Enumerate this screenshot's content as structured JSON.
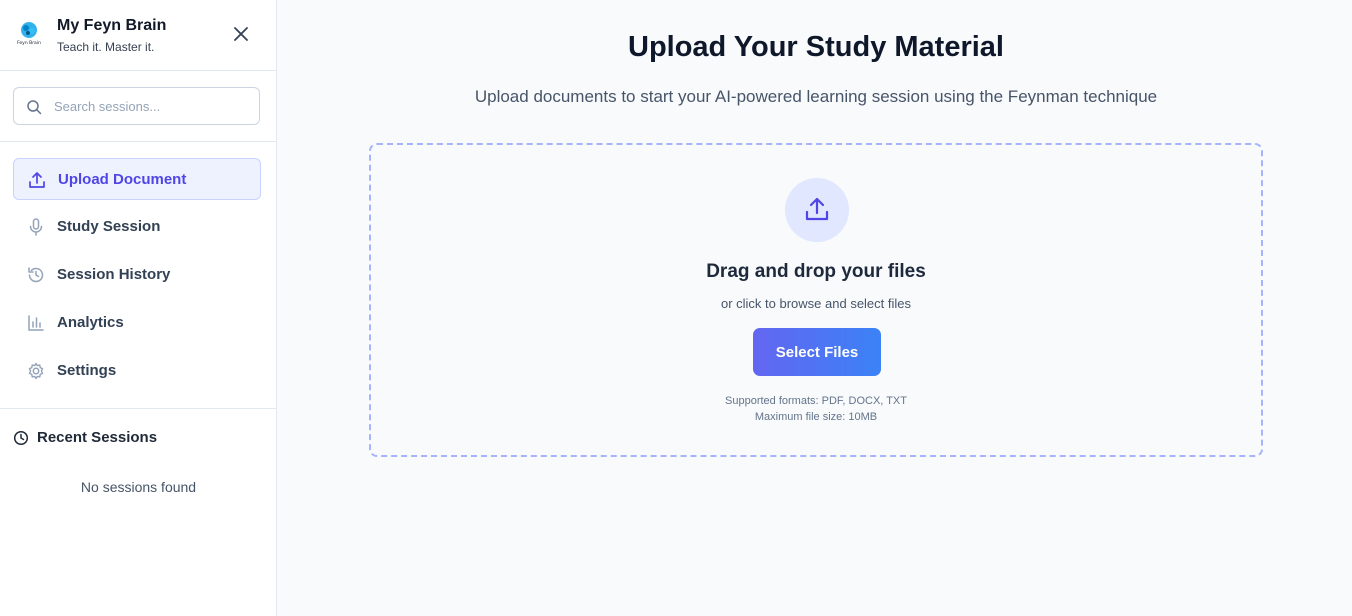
{
  "brand": {
    "name": "My Feyn Brain",
    "tagline": "Teach it. Master it.",
    "logo_text": "Feyn Brain"
  },
  "search": {
    "placeholder": "Search sessions..."
  },
  "nav": {
    "items": [
      {
        "label": "Upload Document",
        "icon": "upload-icon",
        "active": true
      },
      {
        "label": "Study Session",
        "icon": "microphone-icon",
        "active": false
      },
      {
        "label": "Session History",
        "icon": "history-icon",
        "active": false
      },
      {
        "label": "Analytics",
        "icon": "bar-chart-icon",
        "active": false
      },
      {
        "label": "Settings",
        "icon": "gear-icon",
        "active": false
      }
    ]
  },
  "recent": {
    "heading": "Recent Sessions",
    "empty_text": "No sessions found"
  },
  "main": {
    "title": "Upload Your Study Material",
    "subtitle": "Upload documents to start your AI-powered learning session using the Feynman technique",
    "dropzone": {
      "title": "Drag and drop your files",
      "subtitle": "or click to browse and select files",
      "button_label": "Select Files",
      "formats": "Supported formats: PDF, DOCX, TXT",
      "max_size": "Maximum file size: 10MB"
    }
  },
  "colors": {
    "accent": "#4f46e5",
    "button_gradient_start": "#6366f1",
    "button_gradient_end": "#3b82f6",
    "active_bg": "#eef2ff",
    "dropzone_border": "#a5b4fc"
  }
}
